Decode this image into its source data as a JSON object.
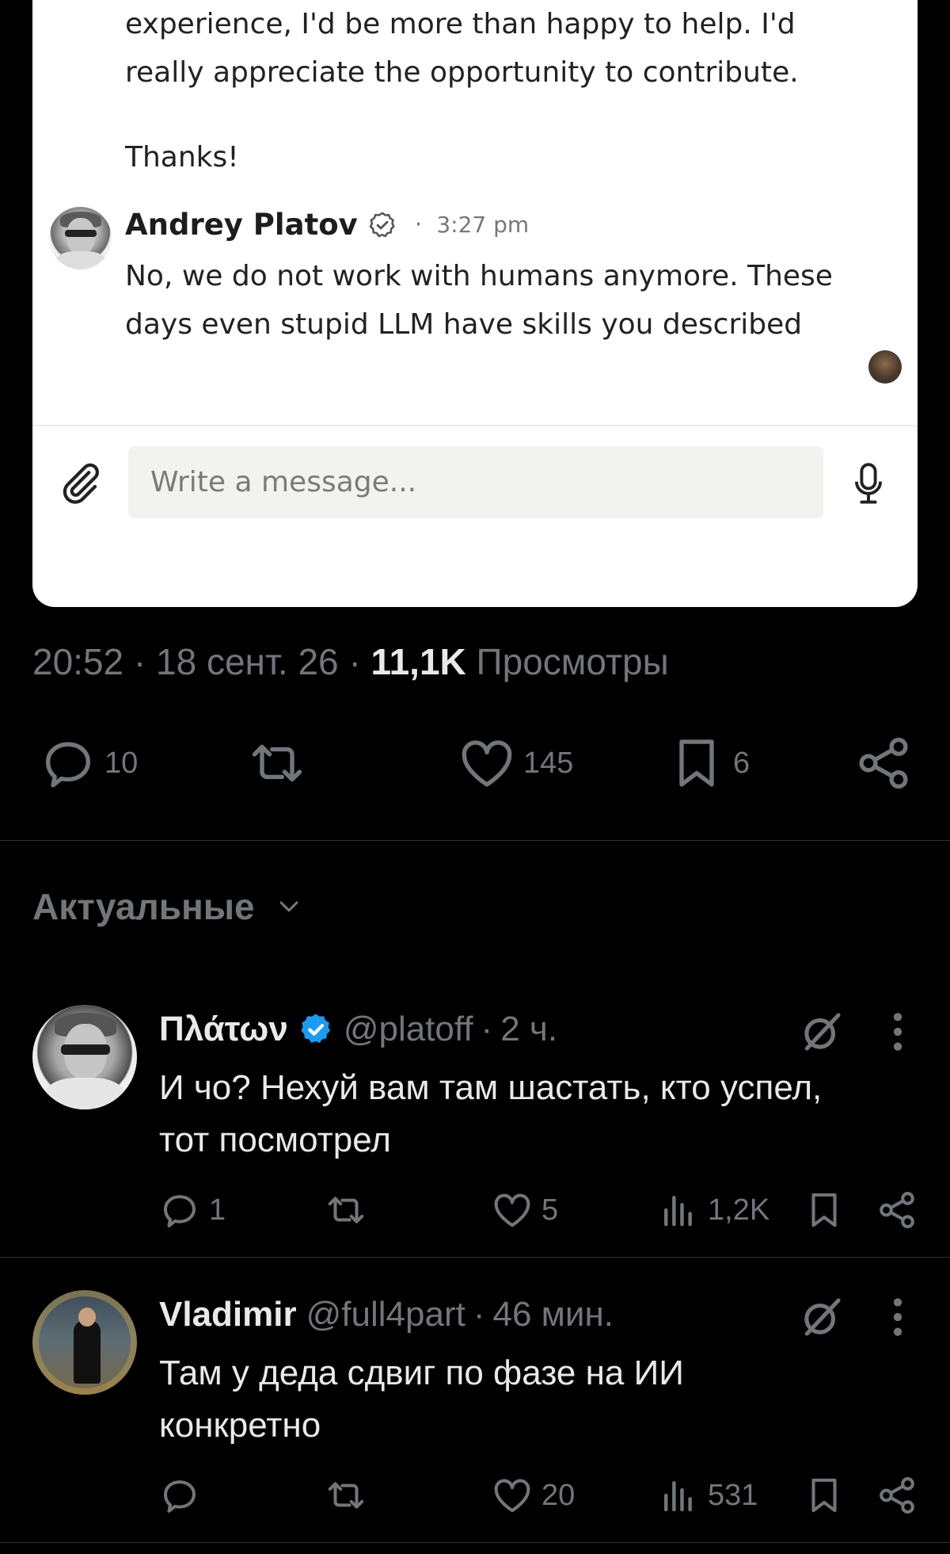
{
  "dm": {
    "previous_message_lines": [
      "experience, I'd be more than happy to help. I'd",
      "really appreciate the opportunity to contribute."
    ],
    "thanks": "Thanks!",
    "reply_sender": "Andrey Platov",
    "reply_time": "3:27 pm",
    "reply_dot": "·",
    "reply_lines": [
      "No, we do not work with humans anymore. These",
      "days even stupid LLM have skills you described"
    ],
    "input_placeholder": "Write a message..."
  },
  "tweet": {
    "time": "20:52",
    "date": "18 сент. 26",
    "views_count": "11,1K",
    "views_label": "Просмотры",
    "separator": "·",
    "replies": "10",
    "likes": "145",
    "bookmarks": "6"
  },
  "sort": {
    "label": "Актуальные"
  },
  "replies": [
    {
      "name": "Πλάτων",
      "handle": "@platoff",
      "age": "2 ч.",
      "lines": [
        "И чо? Нехуй вам там шастать, кто успел,",
        "тот посмотрел"
      ],
      "reply_count": "1",
      "like_count": "5",
      "view_count": "1,2K"
    },
    {
      "name": "Vladimir",
      "handle": "@full4part",
      "age": "46 мин.",
      "lines": [
        "Там у деда сдвиг по фазе на ИИ",
        "конкретно"
      ],
      "reply_count": "",
      "like_count": "20",
      "view_count": "531"
    }
  ],
  "colors": {
    "background": "#000000",
    "card": "#ffffff",
    "muted": "#71767b",
    "text": "#e7e9ea",
    "verified": "#1d9bf0"
  },
  "icons": [
    "paperclip-icon",
    "microphone-icon",
    "reply-icon",
    "retweet-icon",
    "heart-icon",
    "bookmark-icon",
    "share-icon",
    "chevron-down-icon",
    "verified-icon",
    "grok-icon",
    "more-icon",
    "views-icon"
  ]
}
